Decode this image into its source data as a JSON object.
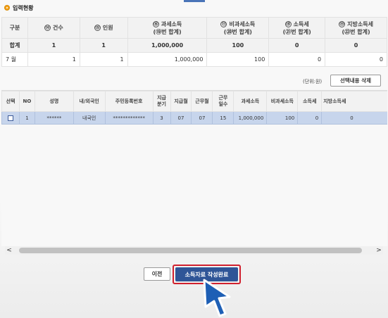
{
  "section": {
    "title": "입력현황"
  },
  "summary": {
    "headers": [
      {
        "num": "",
        "line1": "구분",
        "line2": ""
      },
      {
        "num": "⑭",
        "line1": "건수",
        "line2": ""
      },
      {
        "num": "⑮",
        "line1": "인원",
        "line2": ""
      },
      {
        "num": "⑯",
        "line1": "과세소득",
        "line2": "(⑲번 합계)"
      },
      {
        "num": "⑰",
        "line1": "비과세소득",
        "line2": "(⑳번 합계)"
      },
      {
        "num": "⑱",
        "line1": "소득세",
        "line2": "(㉑번 합계)"
      },
      {
        "num": "⑲",
        "line1": "지방소득세",
        "line2": "(㉒번 합계)"
      }
    ],
    "total_row": [
      "합계",
      "1",
      "1",
      "1,000,000",
      "100",
      "0",
      "0"
    ],
    "month_row": [
      "7 월",
      "1",
      "1",
      "1,000,000",
      "100",
      "0",
      "0"
    ]
  },
  "unit_label": "(단위:원)",
  "delete_button": "선택내용 삭제",
  "grid": {
    "headers": [
      [
        "선택"
      ],
      [
        "NO"
      ],
      [
        "성명"
      ],
      [
        "내/외국인"
      ],
      [
        "주민등록번호"
      ],
      [
        "지급",
        "분기"
      ],
      [
        "지급월"
      ],
      [
        "근무월"
      ],
      [
        "근무",
        "일수"
      ],
      [
        "과세소득"
      ],
      [
        "비과세소득"
      ],
      [
        "소득세"
      ],
      [
        "지방소득세"
      ]
    ],
    "rows": [
      [
        "",
        "1",
        "******",
        "내국인",
        "*************",
        "3",
        "07",
        "07",
        "15",
        "1,000,000",
        "100",
        "0",
        "0"
      ]
    ]
  },
  "scrollbar": {
    "left_arrow": "<",
    "right_arrow": ">"
  },
  "buttons": {
    "prev": "이전",
    "complete": "소득자료 작성완료"
  },
  "colors": {
    "primary": "#2f5597",
    "highlight": "#d0202e",
    "selected_row": "#c7d5ec",
    "cursor": "#1e5fb5"
  }
}
